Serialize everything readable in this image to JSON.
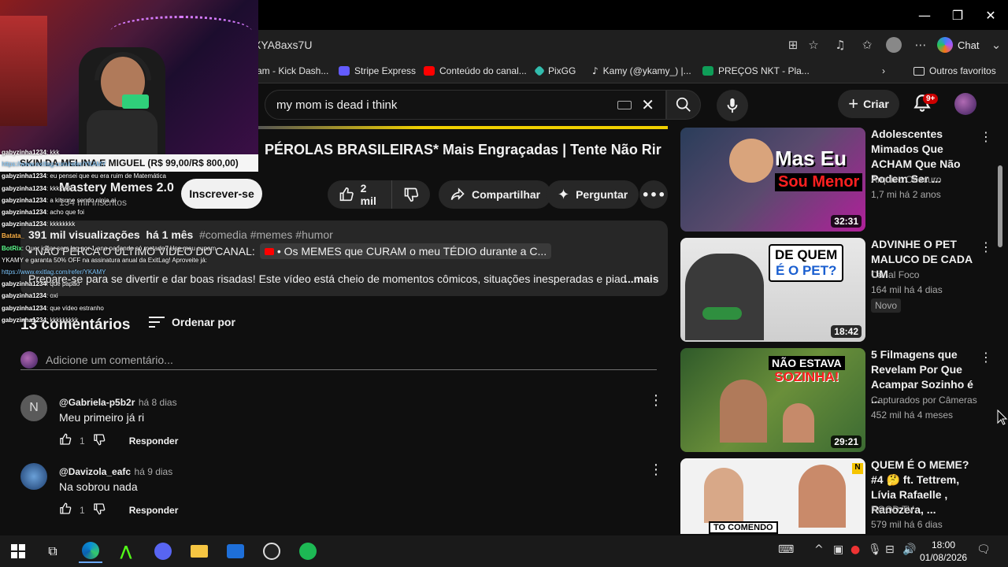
{
  "browser": {
    "address": "XYA8axs7U",
    "chat_label": "Chat",
    "bookmarks": [
      {
        "label": "am - Kick Dash...",
        "color": "#53fc18"
      },
      {
        "label": "Stripe Express",
        "color": "#635bff"
      },
      {
        "label": "Conteúdo do canal...",
        "color": "#ff0000"
      },
      {
        "label": "PixGG",
        "color": "#32bcad"
      },
      {
        "label": "Kamy (@ykamy_) |...",
        "color": "#000000"
      },
      {
        "label": "PREÇOS NKT - Pla...",
        "color": "#0f9d58"
      }
    ],
    "other_favorites": "Outros favoritos"
  },
  "youtube": {
    "search_query": "my mom is dead i think",
    "create_label": "Criar",
    "notification_count": "9+"
  },
  "video": {
    "title": "PÉROLAS BRASILEIRAS* Mais Engraçadas | Tente Não Rir",
    "channel": "Mastery Memes 2.0",
    "subscribers": "134 mil inscritos",
    "subscribe_label": "Inscrever-se",
    "likes": "2 mil",
    "share_label": "Compartilhar",
    "ask_label": "Perguntar",
    "views": "391 mil visualizações",
    "age": "há 1 mês",
    "tags": "#comedia #memes #humor",
    "desc_line1": "• NÃO PERCA O ÚLTIMO VÍDEO DO CANAL:",
    "desc_link": "• Os MEMES que CURAM o meu TÉDIO durante a C...",
    "desc_line2": "Prepare-se para se divertir e dar boas risadas! Este vídeo está cheio de momentos cômicos, situações inesperadas e piadas q",
    "more_label": "...mais"
  },
  "comments": {
    "count_label": "13 comentários",
    "sort_label": "Ordenar por",
    "add_placeholder": "Adicione um comentário...",
    "items": [
      {
        "initial": "N",
        "handle": "@Gabriela-p5b2r",
        "time": "há 8 dias",
        "text": "Meu primeiro já ri",
        "likes": "1",
        "reply": "Responder"
      },
      {
        "initial": "",
        "handle": "@Davizola_eafc",
        "time": "há 9 dias",
        "text": "Na sobrou nada",
        "likes": "1",
        "reply": "Responder"
      }
    ]
  },
  "recommendations": [
    {
      "title": "Adolescentes Mimados Que ACHAM Que Não Podem Ser ...",
      "channel": "Arquivo Obscuro",
      "meta": "1,7 mi  há 2 anos",
      "duration": "32:31",
      "overlay1": "Mas Eu",
      "overlay2": "Sou Menor"
    },
    {
      "title": "ADVINHE O PET MALUCO DE CADA UM",
      "channel": "Canal Foco",
      "meta": "164 mil  há 4 dias",
      "duration": "18:42",
      "badge": "Novo",
      "overlay1": "DE QUEM",
      "overlay2": "É O PET?"
    },
    {
      "title": "5 Filmagens que Revelam Por Que Acampar Sozinho é ...",
      "channel": "Capturados por Câmeras",
      "meta": "452 mil  há 4 meses",
      "duration": "29:21",
      "overlay1": "NÃO ESTAVA",
      "overlay2": "SOZINHA!"
    },
    {
      "title": "QUEM É O MEME? #4 🤔 ft. Tettrem, Lívia Rafaelle , Ranozera, ...",
      "channel": "NOOD TV",
      "meta": "579 mil  há 6 dias",
      "duration": "",
      "overlay1": "TO COMENDO",
      "overlay2": ""
    }
  ],
  "stream_overlay": {
    "banner": "SKIN DA MELINA E MIGUEL (R$ 99,00/R$ 800,00)",
    "chat": [
      {
        "user": "gabyzinha1234",
        "msg": ": kkk"
      },
      {
        "user": "",
        "msg": "https://www.exitlag.com/refer/YKAMY"
      },
      {
        "user": "gabyzinha1234",
        "msg": ": eu pensei que eu era ruim de Matemática"
      },
      {
        "user": "gabyzinha1234",
        "msg": ": kkkkkkk"
      },
      {
        "user": "gabyzinha1234",
        "msg": ": a kitsune sendo ninja ai"
      },
      {
        "user": "gabyzinha1234",
        "msg": ": acho que foi"
      },
      {
        "user": "gabyzinha1234",
        "msg": ": kkkkkkkk"
      },
      {
        "user": "Batata_",
        "msg": ""
      },
      {
        "user": "BotRix",
        "msg": ": Quer jogar sem lag por 1 ano pagando só metade? Use meu cupom"
      },
      {
        "user": "",
        "msg": "YKAMY e garanta 50% OFF na assinatura anual da ExitLag! Aproveite já:"
      },
      {
        "user": "",
        "msg": "https://www.exitlag.com/refer/YKAMY"
      },
      {
        "user": "gabyzinha1234",
        "msg": ": que papão"
      },
      {
        "user": "gabyzinha1234",
        "msg": ": oxi"
      },
      {
        "user": "gabyzinha1234",
        "msg": ": que vídeo estranho"
      },
      {
        "user": "gabyzinha1234",
        "msg": ": kkkkkkkkk"
      }
    ]
  },
  "taskbar": {
    "time": "18:00",
    "date": "01/08/2026"
  }
}
